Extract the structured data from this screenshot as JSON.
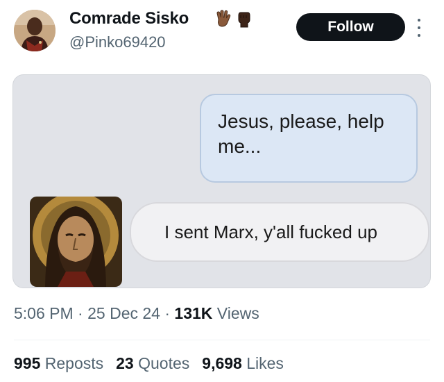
{
  "author": {
    "display_name": "Comrade Sisko",
    "handle": "@Pinko69420",
    "emojis": [
      "vulcan-salute-icon",
      "raised-fist-icon"
    ]
  },
  "follow_label": "Follow",
  "media": {
    "sent_message": "Jesus, please, help me...",
    "received_message": "I sent Marx, y'all fucked up",
    "contact_icon": "jesus-icon-portrait"
  },
  "meta": {
    "time": "5:06 PM",
    "date": "25 Dec 24",
    "views_count": "131K",
    "views_label": "Views",
    "separator": "·"
  },
  "stats": [
    {
      "count": "995",
      "label": "Reposts"
    },
    {
      "count": "23",
      "label": "Quotes"
    },
    {
      "count": "9,698",
      "label": "Likes"
    }
  ],
  "colors": {
    "secondary_text": "#536471",
    "primary_text": "#0f1419",
    "follow_bg": "#0f1419",
    "sent_bubble": "#dce7f5",
    "received_bubble": "#f1f1f3"
  }
}
